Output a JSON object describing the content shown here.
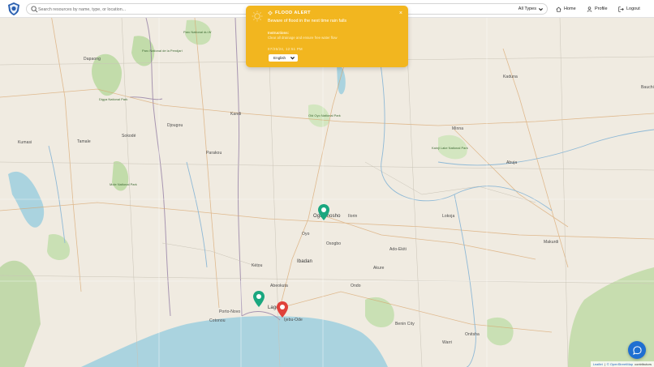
{
  "search": {
    "placeholder": "Search resources by name, type, or location..."
  },
  "filter": {
    "label": "All Types"
  },
  "nav": {
    "home": "Home",
    "profile": "Profile",
    "logout": "Logout"
  },
  "alert": {
    "title": "FLOOD ALERT",
    "message": "Beware of flood in the next time rain falls",
    "instructions_label": "Instructions:",
    "instructions": "Clear all drainage and ensure free water flow",
    "time": "07/25/24, 12:51 PM",
    "language": "English"
  },
  "map": {
    "places": [
      {
        "name": "Ogbomosho"
      },
      {
        "name": "Oyo"
      },
      {
        "name": "Ibadan"
      },
      {
        "name": "Lagos"
      },
      {
        "name": "Porto-Novo"
      },
      {
        "name": "Cotonou"
      },
      {
        "name": "Abeokuta"
      },
      {
        "name": "Akure"
      },
      {
        "name": "Benin City"
      },
      {
        "name": "Onitsha"
      },
      {
        "name": "Makurdi"
      },
      {
        "name": "Kumasi"
      },
      {
        "name": "Tamale"
      },
      {
        "name": "Dapaong"
      },
      {
        "name": "Sokodé"
      },
      {
        "name": "Ilorin"
      },
      {
        "name": "Minna"
      },
      {
        "name": "Abuja"
      },
      {
        "name": "Kaduna"
      },
      {
        "name": "Bauchi"
      },
      {
        "name": "Parakou"
      },
      {
        "name": "Djougou"
      },
      {
        "name": "Kétou"
      },
      {
        "name": "Osogbo"
      },
      {
        "name": "Ado-Ekiti"
      },
      {
        "name": "Lokoja"
      },
      {
        "name": "Kandi"
      },
      {
        "name": "Ijebu-Ode"
      },
      {
        "name": "Warri"
      },
      {
        "name": "Ondo"
      }
    ],
    "parks": [
      {
        "name": "Parc National de la Pendjari"
      },
      {
        "name": "Parc National du W"
      },
      {
        "name": "Digya National Park"
      },
      {
        "name": "Mole National Park"
      },
      {
        "name": "Kainji Lake National Park"
      },
      {
        "name": "Old Oyo National Park"
      }
    ],
    "markers": [
      {
        "name": "Ogbomosho",
        "color": "#1aa77f"
      },
      {
        "name": "Lagos West",
        "color": "#1aa77f"
      },
      {
        "name": "Lagos",
        "color": "#e0413a"
      }
    ]
  },
  "attribution": {
    "leaflet": "Leaflet",
    "sep": "|",
    "osm": "© OpenStreetMap",
    "contributors": "contributors"
  },
  "colors": {
    "alert": "#f2b61f",
    "accent": "#1f6fd1",
    "marker_green": "#1aa77f",
    "marker_red": "#e0413a"
  }
}
